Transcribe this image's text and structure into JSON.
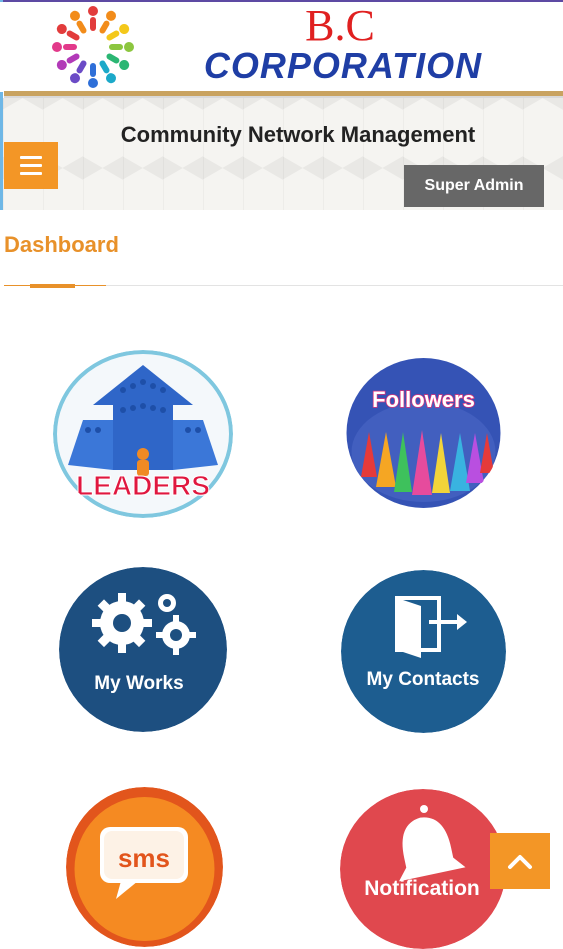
{
  "brand": {
    "line1": "B.C",
    "line2": "CORPORATION"
  },
  "header": {
    "title": "Community Network Management",
    "role_button": "Super Admin",
    "menu_icon": "hamburger-icon"
  },
  "dashboard": {
    "title": "Dashboard",
    "tiles": [
      {
        "id": "leaders",
        "label": "LEADERS"
      },
      {
        "id": "followers",
        "label": "Followers"
      },
      {
        "id": "my-works",
        "label": "My Works"
      },
      {
        "id": "my-contacts",
        "label": "My Contacts"
      },
      {
        "id": "sms",
        "label": "sms"
      },
      {
        "id": "notification",
        "label": "Notification"
      }
    ]
  },
  "scroll_top_icon": "chevron-up-icon",
  "colors": {
    "accent": "#f39626",
    "dashboard_title": "#e8912a",
    "brand_red": "#e02020",
    "brand_blue": "#1f3ea5",
    "tile_blue": "#1d4f80",
    "badge_grey": "#676767"
  }
}
